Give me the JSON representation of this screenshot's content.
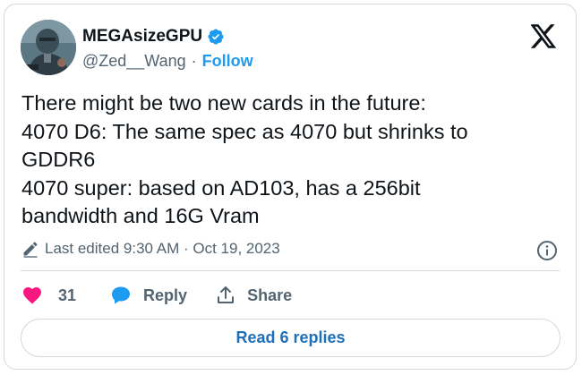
{
  "author": {
    "display_name": "MEGAsizeGPU",
    "handle": "@Zed__Wang",
    "separator": "·",
    "follow_label": "Follow",
    "verified_icon": "verified-badge-icon"
  },
  "tweet": {
    "lines": [
      "There might be two new cards in the future:",
      "4070 D6: The same spec as 4070 but shrinks to",
      "GDDR6",
      "4070 super: based on AD103, has a 256bit",
      "bandwidth and 16G Vram"
    ]
  },
  "meta": {
    "edited_text": "Last edited 9:30 AM · Oct 19, 2023",
    "edited_icon": "pencil-icon",
    "info_icon": "info-icon"
  },
  "actions": {
    "like_count": "31",
    "reply_label": "Reply",
    "share_label": "Share"
  },
  "footer": {
    "read_replies_label": "Read 6 replies"
  },
  "colors": {
    "accent": "#1d9bf0",
    "like": "#f91880",
    "text": "#0f1419",
    "muted": "#536471",
    "border": "#cfd9de"
  }
}
